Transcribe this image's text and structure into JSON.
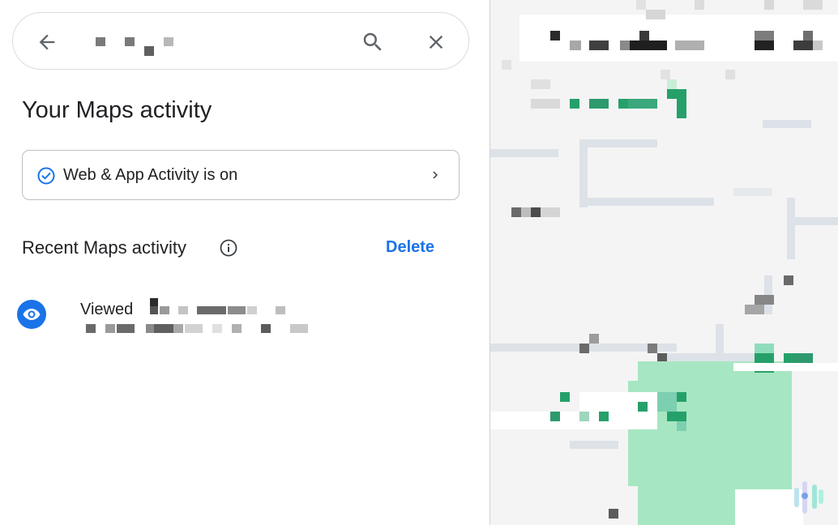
{
  "search": {
    "back_icon": "arrow-left-icon",
    "search_icon": "magnifier-icon",
    "close_icon": "close-icon"
  },
  "panel": {
    "title": "Your Maps activity",
    "activity_card": {
      "label": "Web & App Activity is on",
      "status_icon": "check-circle-icon",
      "chevron_icon": "chevron-right-icon"
    },
    "recent": {
      "title": "Recent Maps activity",
      "info_icon": "info-icon",
      "delete_label": "Delete"
    },
    "items": [
      {
        "icon": "eye-icon",
        "prefix": "Viewed"
      }
    ]
  },
  "colors": {
    "accent": "#1a73e8",
    "text": "#202124",
    "border": "#dadce0",
    "map_bg": "#f4f4f4",
    "park": "#a7e6c2"
  }
}
